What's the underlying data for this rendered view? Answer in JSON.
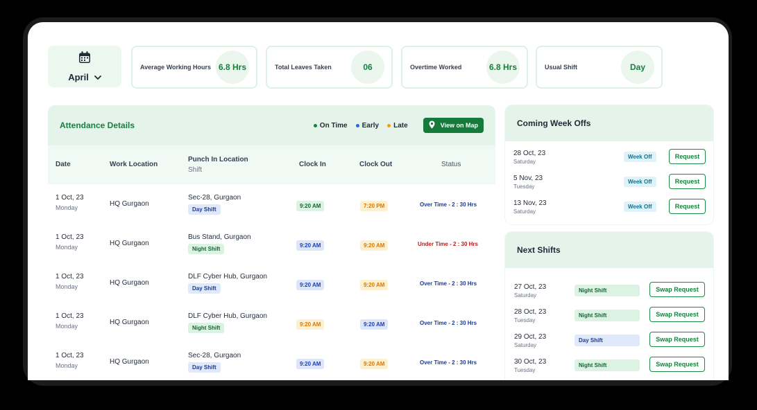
{
  "month": {
    "label": "April"
  },
  "stats": [
    {
      "label": "Average Working Hours",
      "value": "6.8 Hrs"
    },
    {
      "label": "Total Leaves Taken",
      "value": "06"
    },
    {
      "label": "Overtime Worked",
      "value": "6.8 Hrs"
    },
    {
      "label": "Usual Shift",
      "value": "Day"
    }
  ],
  "attendance": {
    "title": "Attendance Details",
    "legend": [
      {
        "label": "On Time",
        "color": "#16803c"
      },
      {
        "label": "Early",
        "color": "#2563eb"
      },
      {
        "label": "Late",
        "color": "#f59e0b"
      }
    ],
    "map_button": "View on Map",
    "columns": {
      "date": "Date",
      "work_location": "Work Location",
      "punch_in": "Punch In Location",
      "shift": "Shift",
      "clock_in": "Clock In",
      "clock_out": "Clock Out",
      "status": "Status"
    },
    "rows": [
      {
        "date": "1 Oct, 23",
        "day": "Monday",
        "work_location": "HQ Gurgaon",
        "punch_location": "Sec-28, Gurgaon",
        "shift": "Day Shift",
        "shift_kind": "day",
        "clock_in": "9:20 AM",
        "clock_in_kind": "green",
        "clock_out": "7:20 PM",
        "clock_out_kind": "yellow",
        "status": "Over Time - 2 : 30  Hrs",
        "status_kind": "over"
      },
      {
        "date": "1 Oct, 23",
        "day": "Monday",
        "work_location": "HQ Gurgaon",
        "punch_location": "Bus Stand, Gurgaon",
        "shift": "Night Shift",
        "shift_kind": "night",
        "clock_in": "9:20 AM",
        "clock_in_kind": "blue",
        "clock_out": "9:20 AM",
        "clock_out_kind": "yellow",
        "status": "Under Time - 2 : 30  Hrs",
        "status_kind": "under"
      },
      {
        "date": "1 Oct, 23",
        "day": "Monday",
        "work_location": "HQ Gurgaon",
        "punch_location": "DLF Cyber Hub, Gurgaon",
        "shift": "Day Shift",
        "shift_kind": "day",
        "clock_in": "9:20 AM",
        "clock_in_kind": "blue",
        "clock_out": "9:20 AM",
        "clock_out_kind": "yellow",
        "status": "Over Time - 2 : 30  Hrs",
        "status_kind": "over"
      },
      {
        "date": "1 Oct, 23",
        "day": "Monday",
        "work_location": "HQ Gurgaon",
        "punch_location": "DLF Cyber Hub, Gurgaon",
        "shift": "Night Shift",
        "shift_kind": "night",
        "clock_in": "9:20 AM",
        "clock_in_kind": "yellow",
        "clock_out": "9:20 AM",
        "clock_out_kind": "blue",
        "status": "Over Time - 2 : 30  Hrs",
        "status_kind": "over"
      },
      {
        "date": "1 Oct, 23",
        "day": "Monday",
        "work_location": "HQ Gurgaon",
        "punch_location": "Sec-28, Gurgaon",
        "shift": "Day Shift",
        "shift_kind": "day",
        "clock_in": "9:20 AM",
        "clock_in_kind": "blue",
        "clock_out": "9:20 AM",
        "clock_out_kind": "yellow",
        "status": "Over Time - 2 : 30  Hrs",
        "status_kind": "over"
      }
    ]
  },
  "week_offs": {
    "title": "Coming Week Offs",
    "items": [
      {
        "date": "28 Oct, 23",
        "day": "Saturday",
        "badge": "Week Off",
        "button": "Request"
      },
      {
        "date": "5 Nov, 23",
        "day": "Tuesday",
        "badge": "Week Off",
        "button": "Request"
      },
      {
        "date": "13 Nov, 23",
        "day": "Saturday",
        "badge": "Week Off",
        "button": "Request"
      }
    ]
  },
  "next_shifts": {
    "title": "Next Shifts",
    "items": [
      {
        "date": "27 Oct, 23",
        "day": "Saturday",
        "shift": "Night Shift",
        "shift_kind": "night",
        "button": "Swap Request"
      },
      {
        "date": "28 Oct, 23",
        "day": "Tuesday",
        "shift": "Night Shift",
        "shift_kind": "night",
        "button": "Swap Request"
      },
      {
        "date": "29 Oct, 23",
        "day": "Saturday",
        "shift": "Day Shift",
        "shift_kind": "day",
        "button": "Swap Request"
      },
      {
        "date": "30 Oct, 23",
        "day": "Tuesday",
        "shift": "Night Shift",
        "shift_kind": "night",
        "button": "Swap Request"
      }
    ]
  }
}
